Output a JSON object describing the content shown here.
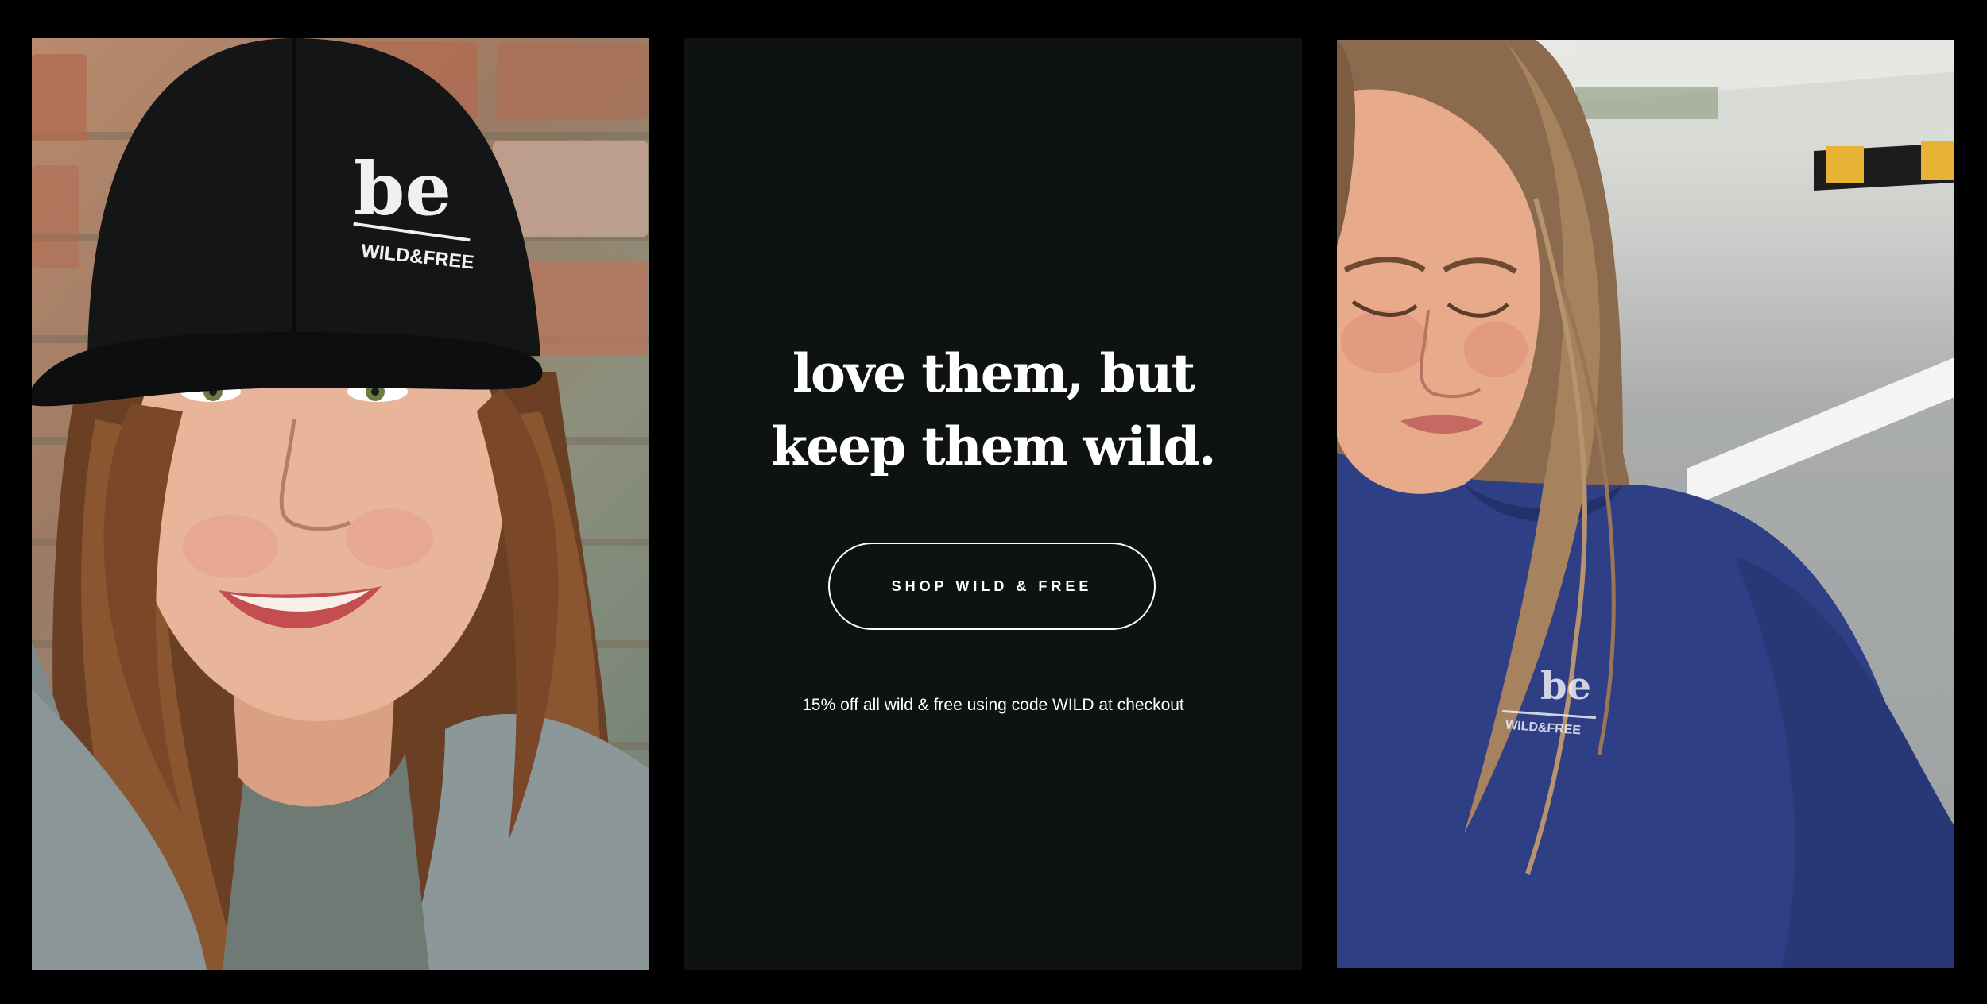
{
  "promo_banner": {
    "headline_line1": "love them, but",
    "headline_line2": "keep them wild.",
    "cta_label": "SHOP WILD & FREE",
    "promo_text": "15% off all wild & free using code WILD at checkout"
  },
  "left_photo": {
    "cap_logo_main": "be",
    "cap_logo_sub": "WILD&FREE"
  },
  "right_photo": {
    "sweatshirt_logo_main": "be",
    "sweatshirt_logo_sub": "WILD&FREE"
  },
  "colors": {
    "page_background": "#000000",
    "center_panel_background": "#0e1213",
    "text": "#ffffff",
    "cap": "#121314",
    "sweatshirt_blue": "#2e3f86"
  }
}
